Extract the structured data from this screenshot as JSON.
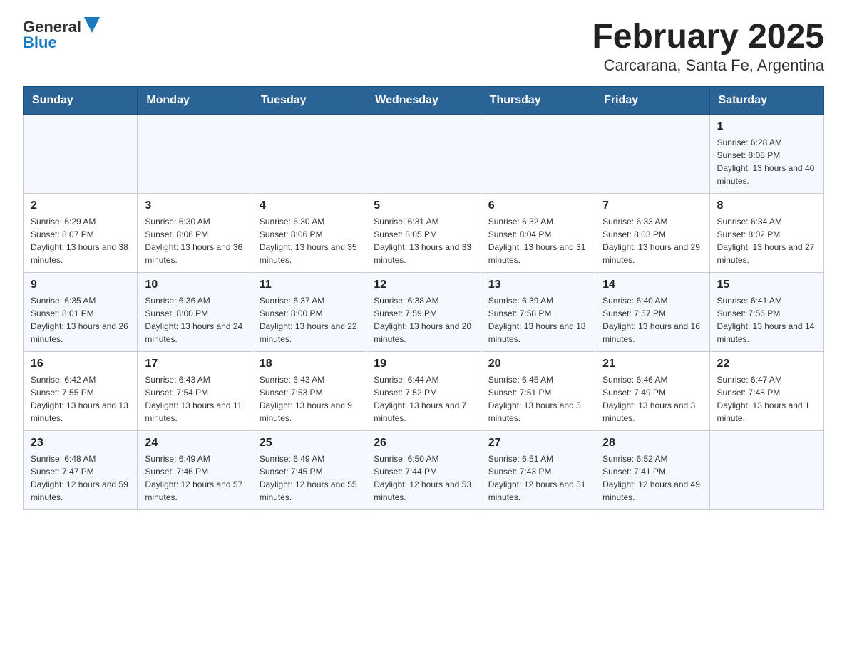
{
  "header": {
    "logo_text": "General",
    "logo_text2": "Blue",
    "title": "February 2025",
    "subtitle": "Carcarana, Santa Fe, Argentina"
  },
  "calendar": {
    "days_of_week": [
      "Sunday",
      "Monday",
      "Tuesday",
      "Wednesday",
      "Thursday",
      "Friday",
      "Saturday"
    ],
    "weeks": [
      [
        {
          "day": "",
          "info": ""
        },
        {
          "day": "",
          "info": ""
        },
        {
          "day": "",
          "info": ""
        },
        {
          "day": "",
          "info": ""
        },
        {
          "day": "",
          "info": ""
        },
        {
          "day": "",
          "info": ""
        },
        {
          "day": "1",
          "info": "Sunrise: 6:28 AM\nSunset: 8:08 PM\nDaylight: 13 hours and 40 minutes."
        }
      ],
      [
        {
          "day": "2",
          "info": "Sunrise: 6:29 AM\nSunset: 8:07 PM\nDaylight: 13 hours and 38 minutes."
        },
        {
          "day": "3",
          "info": "Sunrise: 6:30 AM\nSunset: 8:06 PM\nDaylight: 13 hours and 36 minutes."
        },
        {
          "day": "4",
          "info": "Sunrise: 6:30 AM\nSunset: 8:06 PM\nDaylight: 13 hours and 35 minutes."
        },
        {
          "day": "5",
          "info": "Sunrise: 6:31 AM\nSunset: 8:05 PM\nDaylight: 13 hours and 33 minutes."
        },
        {
          "day": "6",
          "info": "Sunrise: 6:32 AM\nSunset: 8:04 PM\nDaylight: 13 hours and 31 minutes."
        },
        {
          "day": "7",
          "info": "Sunrise: 6:33 AM\nSunset: 8:03 PM\nDaylight: 13 hours and 29 minutes."
        },
        {
          "day": "8",
          "info": "Sunrise: 6:34 AM\nSunset: 8:02 PM\nDaylight: 13 hours and 27 minutes."
        }
      ],
      [
        {
          "day": "9",
          "info": "Sunrise: 6:35 AM\nSunset: 8:01 PM\nDaylight: 13 hours and 26 minutes."
        },
        {
          "day": "10",
          "info": "Sunrise: 6:36 AM\nSunset: 8:00 PM\nDaylight: 13 hours and 24 minutes."
        },
        {
          "day": "11",
          "info": "Sunrise: 6:37 AM\nSunset: 8:00 PM\nDaylight: 13 hours and 22 minutes."
        },
        {
          "day": "12",
          "info": "Sunrise: 6:38 AM\nSunset: 7:59 PM\nDaylight: 13 hours and 20 minutes."
        },
        {
          "day": "13",
          "info": "Sunrise: 6:39 AM\nSunset: 7:58 PM\nDaylight: 13 hours and 18 minutes."
        },
        {
          "day": "14",
          "info": "Sunrise: 6:40 AM\nSunset: 7:57 PM\nDaylight: 13 hours and 16 minutes."
        },
        {
          "day": "15",
          "info": "Sunrise: 6:41 AM\nSunset: 7:56 PM\nDaylight: 13 hours and 14 minutes."
        }
      ],
      [
        {
          "day": "16",
          "info": "Sunrise: 6:42 AM\nSunset: 7:55 PM\nDaylight: 13 hours and 13 minutes."
        },
        {
          "day": "17",
          "info": "Sunrise: 6:43 AM\nSunset: 7:54 PM\nDaylight: 13 hours and 11 minutes."
        },
        {
          "day": "18",
          "info": "Sunrise: 6:43 AM\nSunset: 7:53 PM\nDaylight: 13 hours and 9 minutes."
        },
        {
          "day": "19",
          "info": "Sunrise: 6:44 AM\nSunset: 7:52 PM\nDaylight: 13 hours and 7 minutes."
        },
        {
          "day": "20",
          "info": "Sunrise: 6:45 AM\nSunset: 7:51 PM\nDaylight: 13 hours and 5 minutes."
        },
        {
          "day": "21",
          "info": "Sunrise: 6:46 AM\nSunset: 7:49 PM\nDaylight: 13 hours and 3 minutes."
        },
        {
          "day": "22",
          "info": "Sunrise: 6:47 AM\nSunset: 7:48 PM\nDaylight: 13 hours and 1 minute."
        }
      ],
      [
        {
          "day": "23",
          "info": "Sunrise: 6:48 AM\nSunset: 7:47 PM\nDaylight: 12 hours and 59 minutes."
        },
        {
          "day": "24",
          "info": "Sunrise: 6:49 AM\nSunset: 7:46 PM\nDaylight: 12 hours and 57 minutes."
        },
        {
          "day": "25",
          "info": "Sunrise: 6:49 AM\nSunset: 7:45 PM\nDaylight: 12 hours and 55 minutes."
        },
        {
          "day": "26",
          "info": "Sunrise: 6:50 AM\nSunset: 7:44 PM\nDaylight: 12 hours and 53 minutes."
        },
        {
          "day": "27",
          "info": "Sunrise: 6:51 AM\nSunset: 7:43 PM\nDaylight: 12 hours and 51 minutes."
        },
        {
          "day": "28",
          "info": "Sunrise: 6:52 AM\nSunset: 7:41 PM\nDaylight: 12 hours and 49 minutes."
        },
        {
          "day": "",
          "info": ""
        }
      ]
    ]
  }
}
